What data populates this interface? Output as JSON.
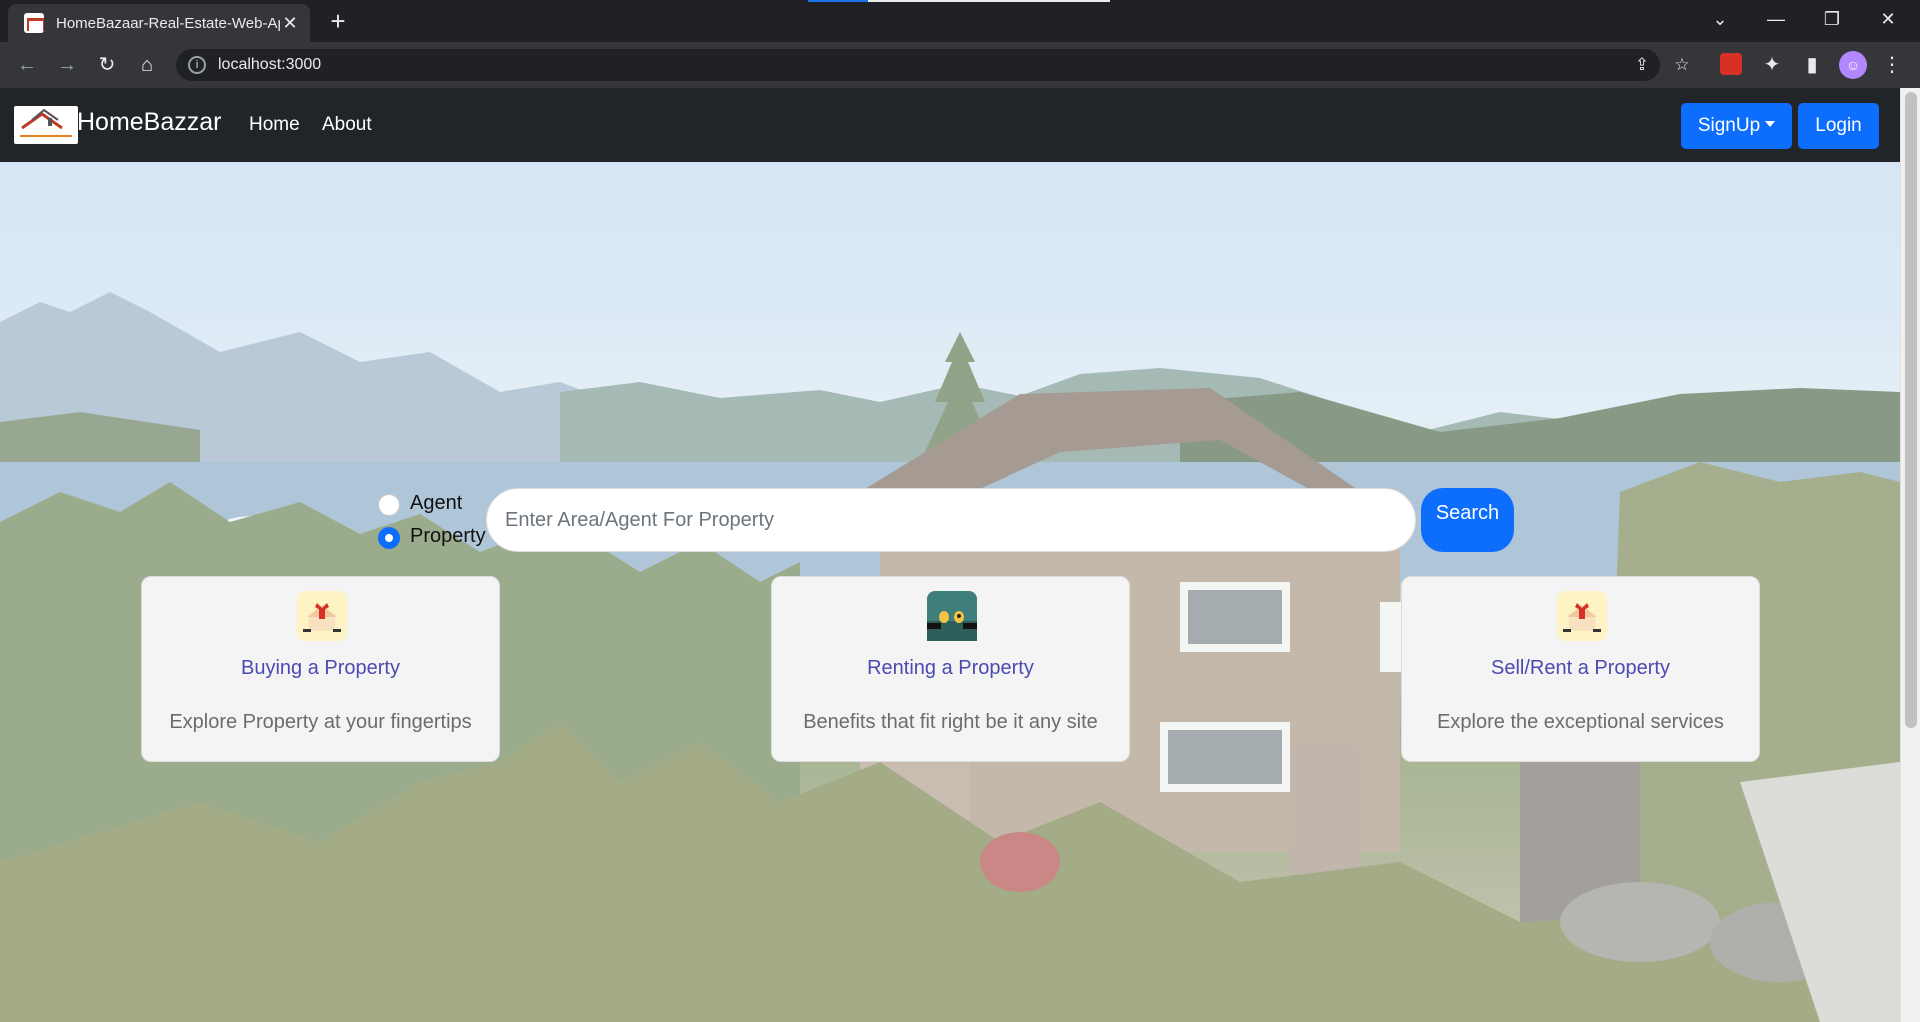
{
  "browser": {
    "tab_title": "HomeBazaar-Real-Estate-Web-App",
    "tab_close": "✕",
    "new_tab": "+",
    "url": "localhost:3000",
    "window_controls": {
      "dropdown": "⌄",
      "minimize": "—",
      "restore": "❐",
      "close": "✕"
    },
    "toolbar_icons": {
      "back": "←",
      "forward": "→",
      "reload": "↻",
      "home": "⌂",
      "share": "⇪",
      "bookmark": "☆",
      "extensions": "✦",
      "sidepanel": "▮",
      "menu": "⋮"
    }
  },
  "navbar": {
    "brand": "HomeBazzar",
    "links": [
      "Home",
      "About"
    ],
    "signup_label": "SignUp",
    "login_label": "Login"
  },
  "search": {
    "options": [
      {
        "label": "Agent",
        "checked": false
      },
      {
        "label": "Property",
        "checked": true
      }
    ],
    "placeholder": "Enter Area/Agent For Property",
    "button_label": "Search"
  },
  "cards": [
    {
      "title": "Buying a Property",
      "description": "Explore Property at your fingertips",
      "icon": "house-gift-icon",
      "icon_bg": "#fdf3c4"
    },
    {
      "title": "Renting a Property",
      "description": "Benefits that fit right be it any site",
      "icon": "key-hand-icon",
      "icon_bg": "#3f7f7b"
    },
    {
      "title": "Sell/Rent a Property",
      "description": "Explore the exceptional services",
      "icon": "house-gift-icon",
      "icon_bg": "#fdf3c4"
    }
  ],
  "colors": {
    "primary": "#0d6efd",
    "navbar_bg": "#212529",
    "card_title": "#4b4bb0"
  }
}
